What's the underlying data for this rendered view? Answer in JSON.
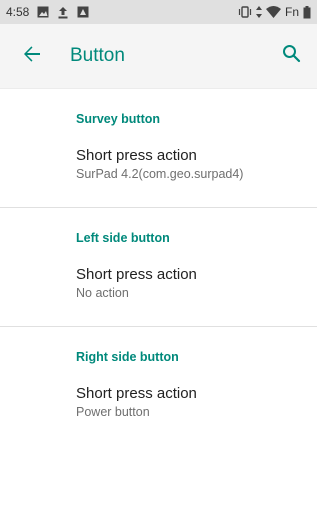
{
  "status_bar": {
    "time": "4:58",
    "carrier_text": "Fn"
  },
  "app_bar": {
    "title": "Button"
  },
  "sections": [
    {
      "header": "Survey button",
      "item_title": "Short press action",
      "item_summary": "SurPad 4.2(com.geo.surpad4)"
    },
    {
      "header": "Left side button",
      "item_title": "Short press action",
      "item_summary": "No action"
    },
    {
      "header": "Right side button",
      "item_title": "Short press action",
      "item_summary": "Power button"
    }
  ],
  "colors": {
    "accent": "#00897b",
    "status_bar": "#e0e0e0",
    "app_bar": "#f5f5f5"
  },
  "icons": {
    "back": "arrow-left-icon",
    "search": "search-icon"
  }
}
